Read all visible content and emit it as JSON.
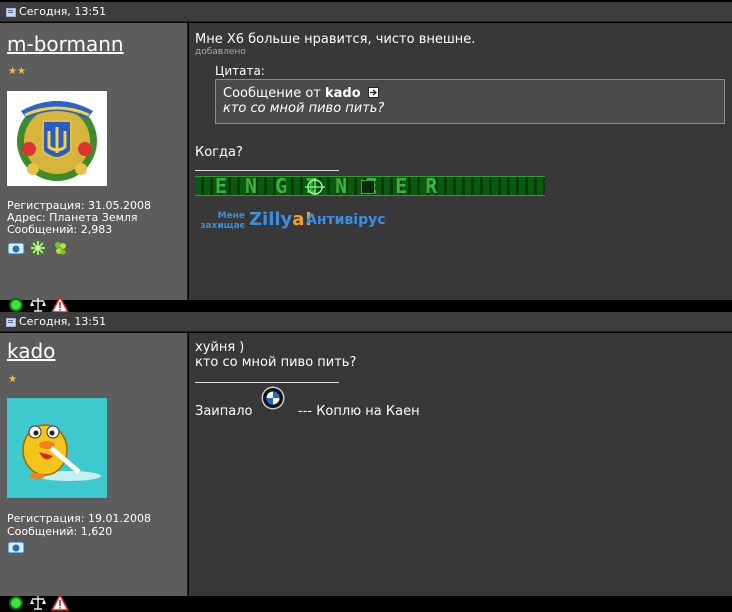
{
  "posts": [
    {
      "date": "Сегодня, 13:51",
      "username": "m-bormann",
      "stars": "★★",
      "info": {
        "reg": "Регистрация: 31.05.2008",
        "address": "Адрес: Планета Земля",
        "messages": "Сообщений: 2,983"
      },
      "message": "Мне X6 больше нравится, чисто внешне.",
      "added": "добавлено",
      "quote": {
        "label": "Цитата:",
        "from_prefix": "Сообщение от",
        "author": "kado",
        "text": "кто со мной пиво пить?"
      },
      "reply": "Когда?",
      "signature": {
        "banner_text": "ENGINEER",
        "zillya_small_1": "Мене",
        "zillya_small_2": "захищає",
        "zillya_brand": "Zilly",
        "zillya_brand_end": "a!",
        "zillya_product": "Антивірус"
      }
    },
    {
      "date": "Сегодня, 13:51",
      "username": "kado",
      "stars": "★",
      "info": {
        "reg": "Регистрация: 19.01.2008",
        "messages": "Сообщений: 1,620"
      },
      "message_line1": "хуйня )",
      "message_line2": "кто со мной пиво пить?",
      "signature": {
        "left": "Заипало",
        "right": "--- Коплю на Каен"
      }
    }
  ]
}
